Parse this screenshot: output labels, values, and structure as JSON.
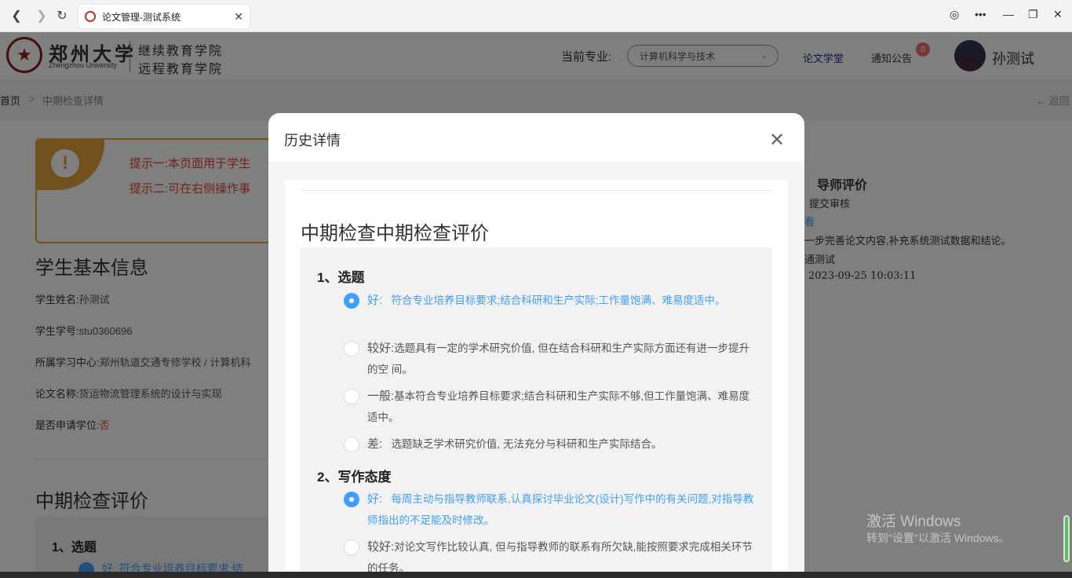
{
  "browser": {
    "tab_title": "论文管理-测试系统",
    "back_icon": "back-arrow-icon",
    "forward_icon": "forward-arrow-icon",
    "reload_icon": "reload-icon"
  },
  "header": {
    "logo_cn": "郑州大学",
    "logo_en": "Zhengzhou University",
    "college_line1": "继续教育学院",
    "college_line2": "远程教育学院",
    "major_label": "当前专业:",
    "major_value": "计算机科学与技术",
    "link_study": "论文学堂",
    "link_notice": "通知公告",
    "notice_count": "0",
    "user_name": "孙测试"
  },
  "breadcrumb": {
    "home": "首页",
    "separator": ">",
    "current": "中期检查详情",
    "back": "返回"
  },
  "page": {
    "tip1": "提示一:本页面用于学生",
    "tip2": "提示二:可在右侧操作事",
    "basic_info_title": "学生基本信息",
    "name_label": "学生姓名:",
    "name_value": "孙测试",
    "id_label": "学生学号:",
    "id_value": "stu0360696",
    "center_label": "所属学习中心:",
    "center_value": "郑州轨道交通专修学校 / 计算机科",
    "thesis_label": "论文名称:",
    "thesis_value": "货运物流管理系统的设计与实现",
    "degree_label": "是否申请学位:",
    "degree_value": "否",
    "eval_title": "中期检查评价",
    "bg_q1": "1、选题",
    "bg_opt1": "好:   符合专业培养目标要求;结"
  },
  "right_panel": {
    "step_title": "导师评价",
    "submit": "提交审核",
    "link": "看",
    "comment": "一步完善论文内容,补充系统测试数据和结论。",
    "tester": "通测试",
    "time": "2023-09-25 10:03:11"
  },
  "modal": {
    "title": "历史详情",
    "close_icon": "close-icon",
    "inner_title": "中期检查中期检查评价",
    "questions": [
      {
        "title": "1、选题",
        "options": [
          {
            "level": "好:",
            "text": "符合专业培养目标要求;结合科研和生产实际;工作量饱满、难易度适中。",
            "selected": true
          },
          {
            "level": "较好:",
            "text": "选题具有一定的学术研究价值, 但在结合科研和生产实际方面还有进一步提升的空 间。",
            "selected": false
          },
          {
            "level": "一般:",
            "text": "基本符合专业培养目标要求;结合科研和生产实际不够,但工作量饱满、难易度适中。",
            "selected": false
          },
          {
            "level": "差:",
            "text": "选题缺乏学术研究价值, 无法充分与科研和生产实际结合。",
            "selected": false
          }
        ]
      },
      {
        "title": "2、写作态度",
        "options": [
          {
            "level": "好:",
            "text": "每周主动与指导教师联系,认真探讨毕业论文(设计)写作中的有关问题,对指导教师指出的不足能及时修改。",
            "selected": true
          },
          {
            "level": "较好:",
            "text": "对论文写作比较认真, 但与指导教师的联系有所欠缺,能按照要求完成相关环节的任务。",
            "selected": false
          }
        ]
      }
    ]
  },
  "watermark": {
    "line1": "激活 Windows",
    "line2": "转到\"设置\"以激活 Windows。"
  },
  "colors": {
    "accent_blue": "#409eff",
    "warning_orange": "#e6a23c",
    "danger_red": "#e04545",
    "link_navy": "#1a2a8a"
  }
}
